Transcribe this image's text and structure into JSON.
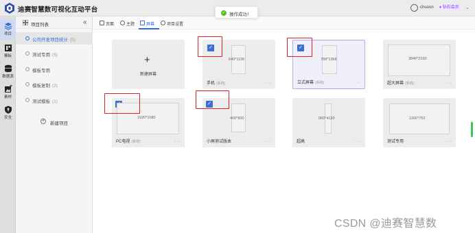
{
  "app": {
    "title": "迪赛智慧数可视化互动平台"
  },
  "toast": {
    "text": "操作成功！",
    "icon": "check-circle-icon",
    "color": "#52c41a"
  },
  "user": {
    "name": "chuoon",
    "vip_label": "钻石会员",
    "vip_icon": "diamond-icon"
  },
  "rail": [
    {
      "label": "项目",
      "icon": "layers-icon",
      "active": true
    },
    {
      "label": "模板",
      "icon": "template-icon",
      "active": false
    },
    {
      "label": "数据源",
      "icon": "database-icon",
      "active": false
    },
    {
      "label": "素材",
      "icon": "image-add-icon",
      "active": false
    },
    {
      "label": "安全",
      "icon": "shield-icon",
      "active": false
    }
  ],
  "panel": {
    "title": "项目列表",
    "collapse": "«",
    "projects": [
      {
        "label": "公司开发项目统计",
        "count": "(5)",
        "active": true
      },
      {
        "label": "测试专用",
        "count": "(5)",
        "active": false
      },
      {
        "label": "模板专用",
        "count": "",
        "active": false
      },
      {
        "label": "模板复制",
        "count": "(2)",
        "active": false
      },
      {
        "label": "测试模板",
        "count": "(1)",
        "active": false
      }
    ],
    "new_project": "新建项目"
  },
  "tabs": [
    {
      "label": "页面",
      "active": false
    },
    {
      "label": "主题",
      "active": false
    },
    {
      "label": "屏幕",
      "active": true
    },
    {
      "label": "项目设置",
      "active": false
    }
  ],
  "new_screen_label": "新建屏幕",
  "screens": [
    {
      "res": "640*1136",
      "name": "手机",
      "tag": "(系统)",
      "checked": true,
      "selected": false
    },
    {
      "res": "768*1368",
      "name": "立式屏幕",
      "tag": "(系统)",
      "checked": true,
      "selected": true
    },
    {
      "res": "3840*2160",
      "name": "超大屏幕",
      "tag": "(系统)",
      "checked": false,
      "selected": false
    },
    {
      "res": "1920*1080",
      "name": "PC电视",
      "tag": "(系统)",
      "checked": true,
      "selected": false
    },
    {
      "res": "400*800",
      "name": "小屏测试版本",
      "tag": "",
      "checked": true,
      "selected": false
    },
    {
      "res": "960*4130",
      "name": "超高",
      "tag": "",
      "checked": false,
      "selected": false
    },
    {
      "res": "1200*752",
      "name": "测试专用",
      "tag": "",
      "checked": false,
      "selected": false
    }
  ],
  "more_label": "···",
  "check_mark": "✓",
  "watermark": "CSDN @迪赛智慧数",
  "colors": {
    "accent": "#2d6be0",
    "checkbox": "#3b6fd6",
    "highlight": "#e02020",
    "vip": "#8a3ffc"
  }
}
